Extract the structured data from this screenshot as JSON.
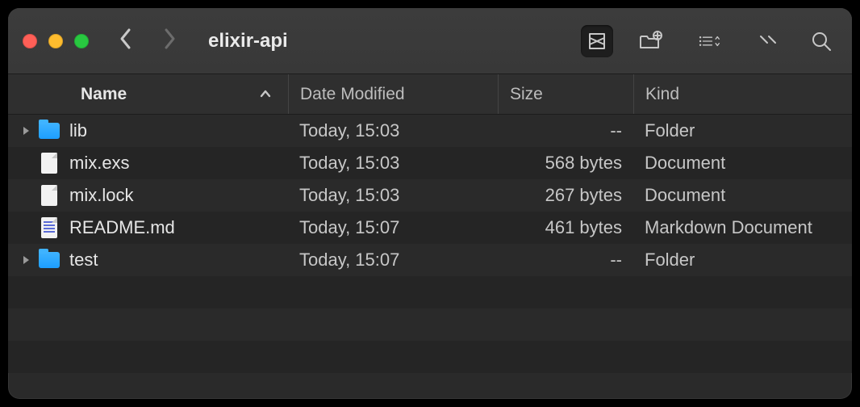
{
  "window": {
    "title": "elixir-api"
  },
  "columns": {
    "name": "Name",
    "date": "Date Modified",
    "size": "Size",
    "kind": "Kind"
  },
  "rows": [
    {
      "expandable": true,
      "icon": "folder",
      "name": "lib",
      "date": "Today, 15:03",
      "size": "--",
      "kind": "Folder"
    },
    {
      "expandable": false,
      "icon": "doc",
      "name": "mix.exs",
      "date": "Today, 15:03",
      "size": "568 bytes",
      "kind": "Document"
    },
    {
      "expandable": false,
      "icon": "doc",
      "name": "mix.lock",
      "date": "Today, 15:03",
      "size": "267 bytes",
      "kind": "Document"
    },
    {
      "expandable": false,
      "icon": "md",
      "name": "README.md",
      "date": "Today, 15:07",
      "size": "461 bytes",
      "kind": "Markdown Document"
    },
    {
      "expandable": true,
      "icon": "folder",
      "name": "test",
      "date": "Today, 15:07",
      "size": "--",
      "kind": "Folder"
    }
  ]
}
